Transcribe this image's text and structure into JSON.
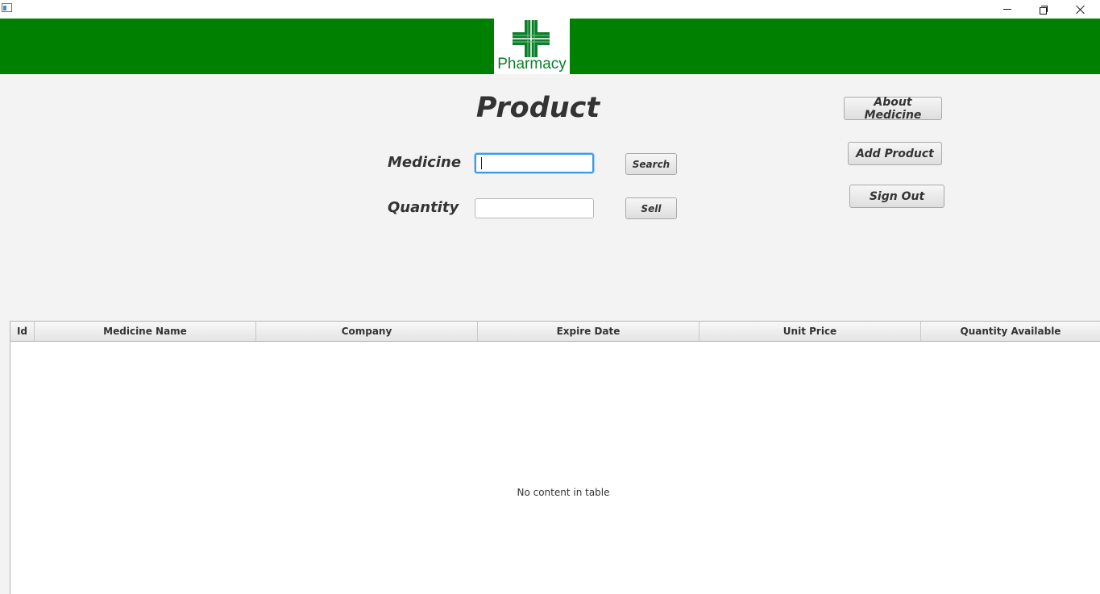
{
  "window": {
    "controls": [
      "minimize-icon",
      "restore-icon",
      "close-icon"
    ]
  },
  "banner": {
    "logo_text": "Pharmacy",
    "color": "#008000"
  },
  "page_title": "Product",
  "form": {
    "medicine_label": "Medicine",
    "medicine_value": "",
    "quantity_label": "Quantity",
    "quantity_value": "",
    "search_button": "Search",
    "sell_button": "Sell"
  },
  "actions": {
    "about_medicine": "About Medicine",
    "add_product": "Add Product",
    "sign_out": "Sign Out"
  },
  "table": {
    "columns": [
      "Id",
      "Medicine Name",
      "Company",
      "Expire Date",
      "Unit Price",
      "Quantity Available"
    ],
    "rows": [],
    "empty_message": "No content in table"
  }
}
